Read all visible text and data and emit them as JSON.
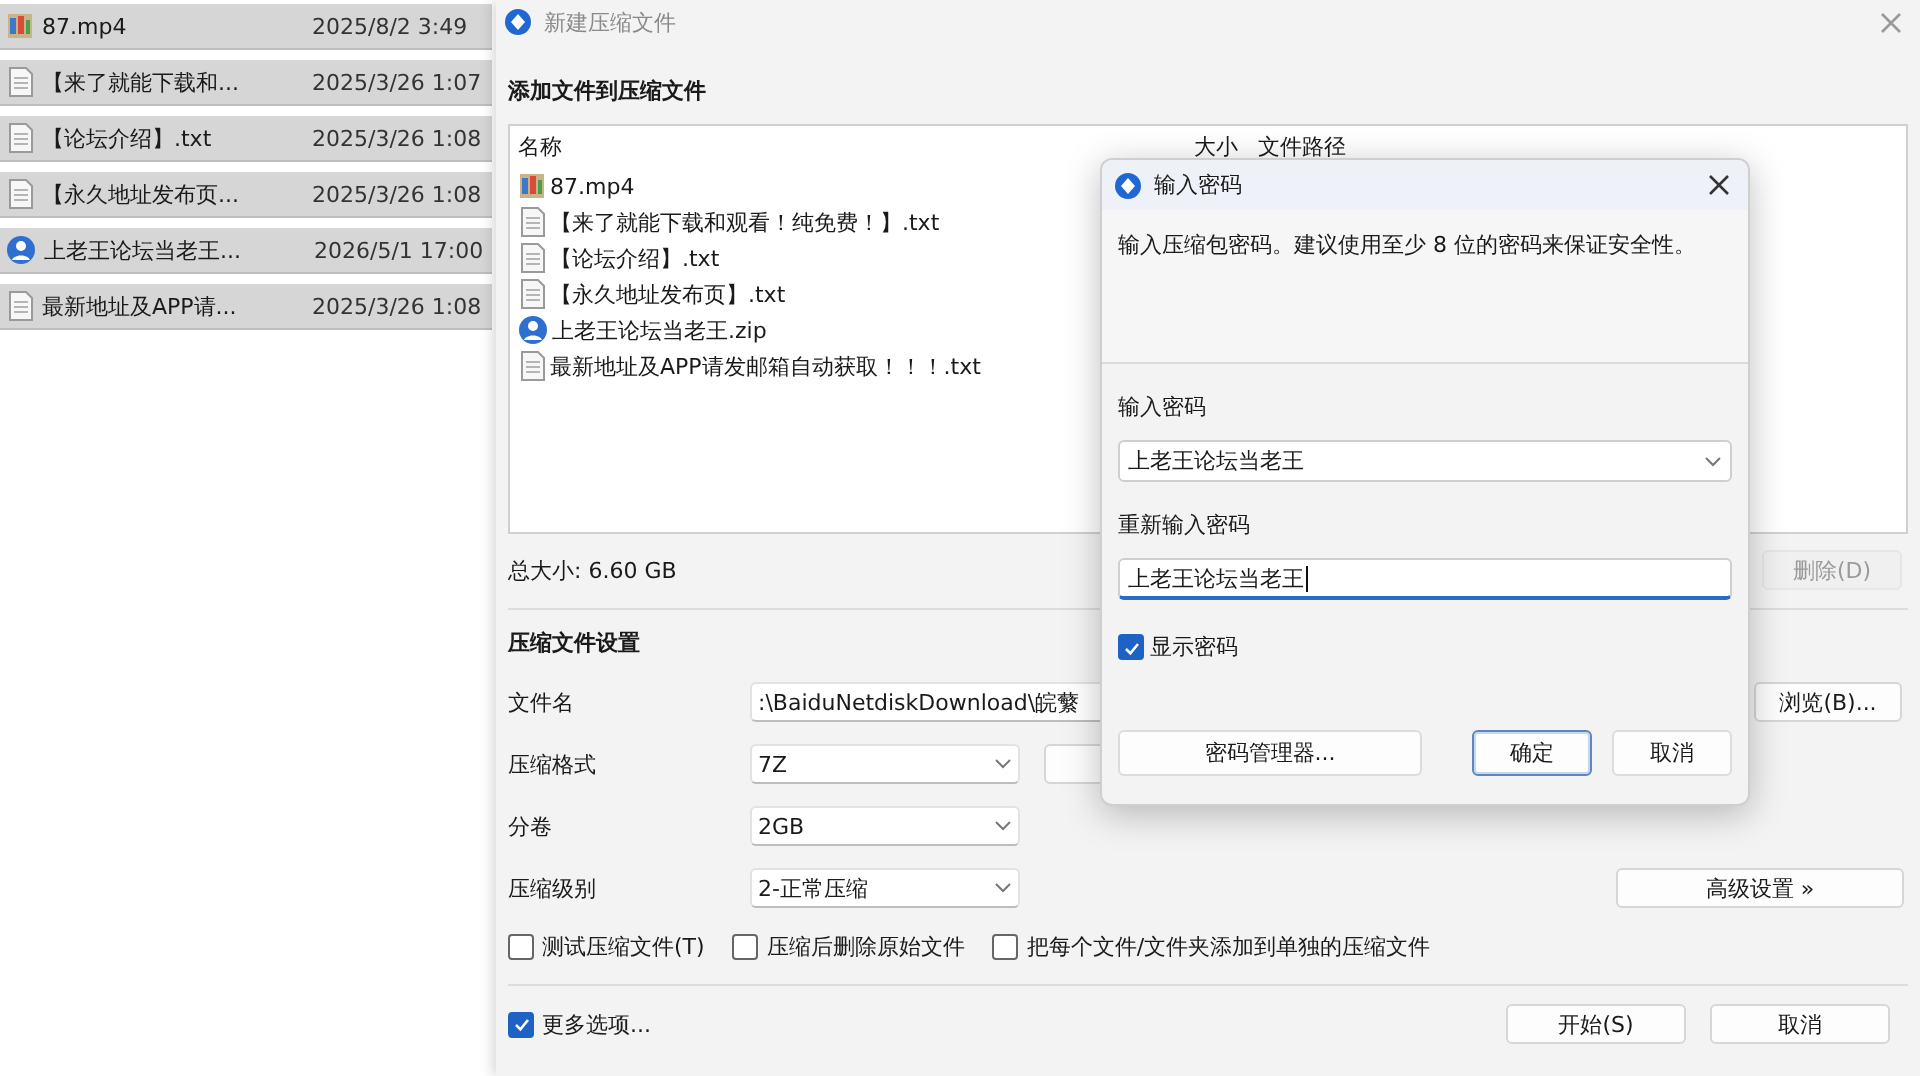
{
  "file_panel": {
    "rows": [
      {
        "name": "87.mp4",
        "date": "2025/8/2 3:49",
        "kind": "video"
      },
      {
        "name": "【来了就能下载和...",
        "date": "2025/3/26 1:07",
        "kind": "text"
      },
      {
        "name": "【论坛介绍】.txt",
        "date": "2025/3/26 1:08",
        "kind": "text"
      },
      {
        "name": "【永久地址发布页...",
        "date": "2025/3/26 1:08",
        "kind": "text"
      },
      {
        "name": "上老王论坛当老王...",
        "date": "2026/5/1 17:00",
        "kind": "archive"
      },
      {
        "name": "最新地址及APP请...",
        "date": "2025/3/26 1:08",
        "kind": "text"
      }
    ]
  },
  "main_window": {
    "title": "新建压缩文件",
    "add_section_title": "添加文件到压缩文件",
    "file_list": {
      "columns": [
        "名称",
        "大小",
        "文件路径"
      ],
      "items": [
        {
          "name": "87.mp4",
          "kind": "video"
        },
        {
          "name": "【来了就能下载和观看！纯免费！】.txt",
          "kind": "text"
        },
        {
          "name": "【论坛介绍】.txt",
          "kind": "text"
        },
        {
          "name": "【永久地址发布页】.txt",
          "kind": "text"
        },
        {
          "name": "上老王论坛当老王.zip",
          "kind": "archive"
        },
        {
          "name": "最新地址及APP请发邮箱自动获取！！！.txt",
          "kind": "text"
        }
      ]
    },
    "total_size": "总大小: 6.60 GB",
    "delete_button": {
      "label": "删除(D)",
      "disabled": true
    },
    "settings_title": "压缩文件设置",
    "filename": {
      "label": "文件名",
      "value": ":\\BaiduNetdiskDownload\\皖蘩"
    },
    "browse_button": "浏览(B)...",
    "format": {
      "label": "压缩格式",
      "value": "7Z"
    },
    "split": {
      "label": "分卷",
      "value": "2GB"
    },
    "level": {
      "label": "压缩级别",
      "value": "2-正常压缩"
    },
    "advanced_button": "高级设置 »",
    "options": [
      {
        "label": "测试压缩文件(T)",
        "checked": false
      },
      {
        "label": "压缩后删除原始文件",
        "checked": false
      },
      {
        "label": "把每个文件/文件夹添加到单独的压缩文件",
        "checked": false
      }
    ],
    "more_options": {
      "label": "更多选项...",
      "checked": true
    },
    "buttons": [
      "开始(S)",
      "取消"
    ]
  },
  "password_dialog": {
    "title": "输入密码",
    "description": "输入压缩包密码。建议使用至少 8 位的密码来保证安全性。",
    "password": {
      "label": "输入密码",
      "value": "上老王论坛当老王"
    },
    "confirm": {
      "label": "重新输入密码",
      "value": "上老王论坛当老王"
    },
    "show_password": {
      "label": "显示密码",
      "checked": true
    },
    "buttons": [
      "密码管理器...",
      "确定",
      "取消"
    ]
  }
}
